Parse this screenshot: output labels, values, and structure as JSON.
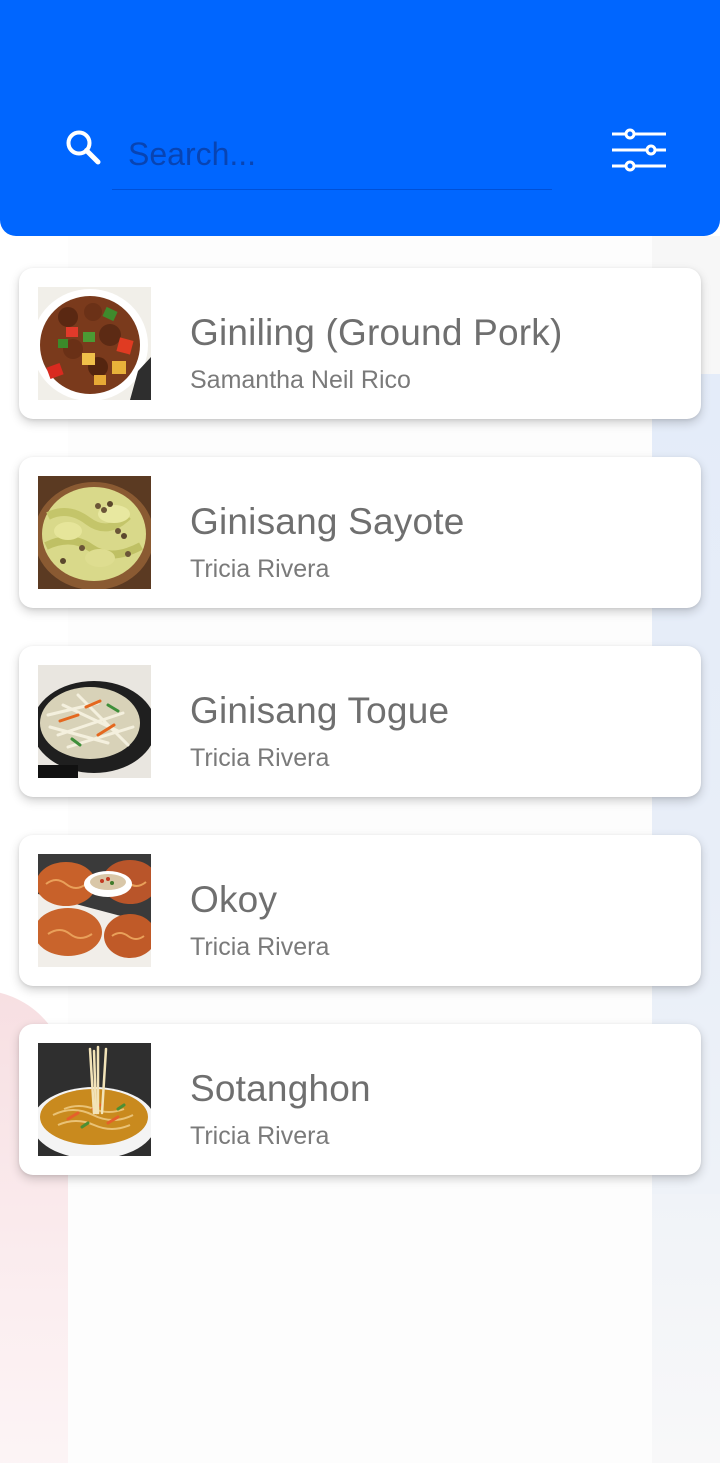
{
  "header": {
    "search": {
      "placeholder": "Search...",
      "value": ""
    },
    "search_icon": "search-icon",
    "filter_icon": "sliders-icon"
  },
  "colors": {
    "header_bg": "#0066ff",
    "title_text": "#6f6f6f",
    "author_text": "#7a7a7a"
  },
  "recipes": [
    {
      "title": "Giniling (Ground Pork)",
      "author": "Samantha Neil Rico",
      "image": "giniling-photo"
    },
    {
      "title": "Ginisang Sayote",
      "author": "Tricia Rivera",
      "image": "ginisang-sayote-photo"
    },
    {
      "title": "Ginisang Togue",
      "author": "Tricia Rivera",
      "image": "ginisang-togue-photo"
    },
    {
      "title": "Okoy",
      "author": "Tricia Rivera",
      "image": "okoy-photo"
    },
    {
      "title": "Sotanghon",
      "author": "Tricia Rivera",
      "image": "sotanghon-photo"
    }
  ]
}
